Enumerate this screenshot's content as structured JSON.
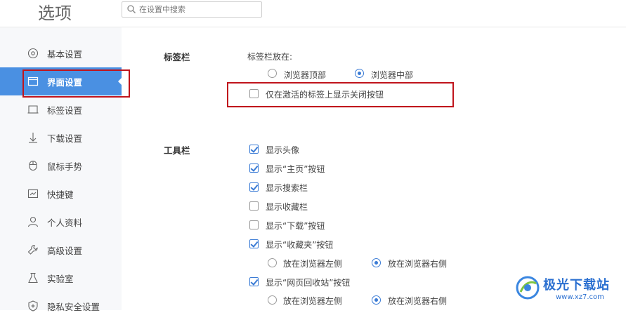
{
  "header": {
    "title": "选项",
    "search_placeholder": "在设置中搜索",
    "search_value": ""
  },
  "sidebar": {
    "items": [
      {
        "label": "基本设置",
        "icon": "circle-settings-icon"
      },
      {
        "label": "界面设置",
        "icon": "window-icon",
        "active": true
      },
      {
        "label": "标签设置",
        "icon": "tab-icon"
      },
      {
        "label": "下载设置",
        "icon": "download-arrow-icon"
      },
      {
        "label": "鼠标手势",
        "icon": "mouse-icon"
      },
      {
        "label": "快捷键",
        "icon": "keyboard-icon"
      },
      {
        "label": "个人资料",
        "icon": "user-icon"
      },
      {
        "label": "高级设置",
        "icon": "wrench-icon"
      },
      {
        "label": "实验室",
        "icon": "flask-icon"
      },
      {
        "label": "隐私安全设置",
        "icon": "shield-plus-icon"
      }
    ]
  },
  "tabbar_section": {
    "title": "标签栏",
    "position_label": "标签栏放在:",
    "position_options": [
      {
        "label": "浏览器顶部",
        "selected": false
      },
      {
        "label": "浏览器中部",
        "selected": true
      }
    ],
    "close_button_option": {
      "label": "仅在激活的标签上显示关闭按钮",
      "checked": false
    }
  },
  "toolbar_section": {
    "title": "工具栏",
    "options": [
      {
        "label": "显示头像",
        "checked": true
      },
      {
        "label": "显示“主页”按钮",
        "checked": true
      },
      {
        "label": "显示搜索栏",
        "checked": true
      },
      {
        "label": "显示收藏栏",
        "checked": false
      },
      {
        "label": "显示“下载”按钮",
        "checked": false
      },
      {
        "label": "显示“收藏夹”按钮",
        "checked": true
      },
      {
        "label": "显示“网页回收站”按钮",
        "checked": true
      }
    ],
    "favorites_position": [
      {
        "label": "放在浏览器左侧",
        "selected": false
      },
      {
        "label": "放在浏览器右侧",
        "selected": true
      }
    ],
    "recycle_position": [
      {
        "label": "放在浏览器左侧",
        "selected": false
      },
      {
        "label": "放在浏览器右侧",
        "selected": true
      }
    ]
  },
  "watermark": {
    "name": "极光下载站",
    "url": "www.xz7.com"
  },
  "colors": {
    "accent": "#4a90e2",
    "highlight_box": "#c0141c",
    "sidebar_bg": "#f7f8fa"
  }
}
